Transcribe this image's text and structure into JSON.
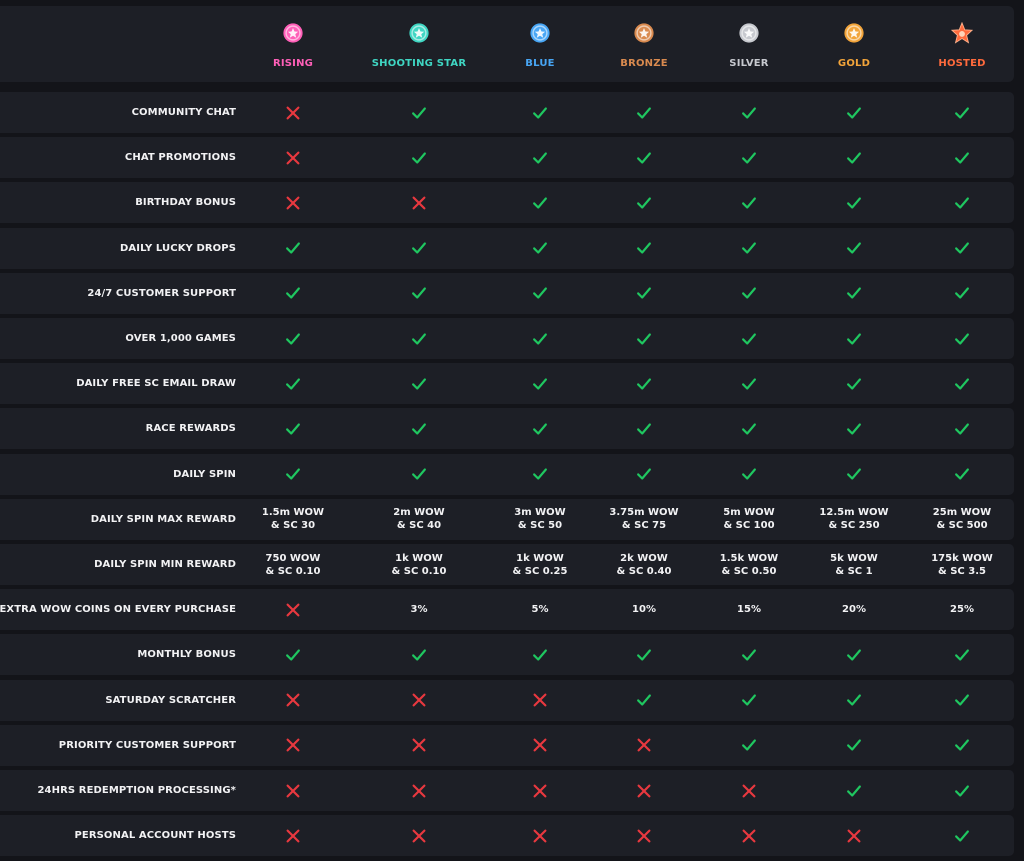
{
  "tiers": [
    {
      "name": "RISING",
      "color": "#ff5fb8",
      "icon": "rising-badge-icon"
    },
    {
      "name": "SHOOTING STAR",
      "color": "#3fd6c3",
      "icon": "shooting-star-badge-icon"
    },
    {
      "name": "BLUE",
      "color": "#48a6f5",
      "icon": "blue-badge-icon"
    },
    {
      "name": "BRONZE",
      "color": "#d98a4f",
      "icon": "bronze-badge-icon"
    },
    {
      "name": "SILVER",
      "color": "#c7c9cf",
      "icon": "silver-badge-icon"
    },
    {
      "name": "GOLD",
      "color": "#f2a43a",
      "icon": "gold-badge-icon"
    },
    {
      "name": "HOSTED",
      "color": "#ff6a3c",
      "icon": "hosted-badge-icon"
    }
  ],
  "colors": {
    "check": "#1fc760",
    "cross": "#e8383f"
  },
  "rows": [
    {
      "label": "COMMUNITY CHAT",
      "cells": [
        "no",
        "yes",
        "yes",
        "yes",
        "yes",
        "yes",
        "yes"
      ]
    },
    {
      "label": "CHAT PROMOTIONS",
      "cells": [
        "no",
        "yes",
        "yes",
        "yes",
        "yes",
        "yes",
        "yes"
      ]
    },
    {
      "label": "BIRTHDAY BONUS",
      "cells": [
        "no",
        "no",
        "yes",
        "yes",
        "yes",
        "yes",
        "yes"
      ]
    },
    {
      "label": "DAILY LUCKY DROPS",
      "cells": [
        "yes",
        "yes",
        "yes",
        "yes",
        "yes",
        "yes",
        "yes"
      ]
    },
    {
      "label": "24/7 CUSTOMER SUPPORT",
      "cells": [
        "yes",
        "yes",
        "yes",
        "yes",
        "yes",
        "yes",
        "yes"
      ]
    },
    {
      "label": "OVER 1,000 GAMES",
      "cells": [
        "yes",
        "yes",
        "yes",
        "yes",
        "yes",
        "yes",
        "yes"
      ]
    },
    {
      "label": "DAILY FREE SC EMAIL DRAW",
      "cells": [
        "yes",
        "yes",
        "yes",
        "yes",
        "yes",
        "yes",
        "yes"
      ]
    },
    {
      "label": "RACE REWARDS",
      "cells": [
        "yes",
        "yes",
        "yes",
        "yes",
        "yes",
        "yes",
        "yes"
      ]
    },
    {
      "label": "DAILY SPIN",
      "cells": [
        "yes",
        "yes",
        "yes",
        "yes",
        "yes",
        "yes",
        "yes"
      ]
    },
    {
      "label": "DAILY SPIN MAX REWARD",
      "cells": [
        "1.5m WOW\n& SC 30",
        "2m WOW\n& SC 40",
        "3m WOW\n& SC 50",
        "3.75m WOW\n& SC 75",
        "5m WOW\n& SC 100",
        "12.5m WOW\n& SC 250",
        "25m WOW\n& SC 500"
      ]
    },
    {
      "label": "DAILY SPIN MIN REWARD",
      "cells": [
        "750 WOW\n& SC 0.10",
        "1k WOW\n& SC 0.10",
        "1k WOW\n& SC 0.25",
        "2k WOW\n& SC 0.40",
        "1.5k WOW\n& SC 0.50",
        "5k WOW\n& SC 1",
        "175k WOW\n& SC 3.5"
      ]
    },
    {
      "label": "EXTRA WOW COINS ON EVERY PURCHASE",
      "cells": [
        "no",
        "3%",
        "5%",
        "10%",
        "15%",
        "20%",
        "25%"
      ]
    },
    {
      "label": "MONTHLY BONUS",
      "cells": [
        "yes",
        "yes",
        "yes",
        "yes",
        "yes",
        "yes",
        "yes"
      ]
    },
    {
      "label": "SATURDAY SCRATCHER",
      "cells": [
        "no",
        "no",
        "no",
        "yes",
        "yes",
        "yes",
        "yes"
      ]
    },
    {
      "label": "PRIORITY CUSTOMER SUPPORT",
      "cells": [
        "no",
        "no",
        "no",
        "no",
        "yes",
        "yes",
        "yes"
      ]
    },
    {
      "label": "24HRS REDEMPTION PROCESSING*",
      "cells": [
        "no",
        "no",
        "no",
        "no",
        "no",
        "yes",
        "yes"
      ]
    },
    {
      "label": "PERSONAL ACCOUNT HOSTS",
      "cells": [
        "no",
        "no",
        "no",
        "no",
        "no",
        "no",
        "yes"
      ]
    }
  ]
}
